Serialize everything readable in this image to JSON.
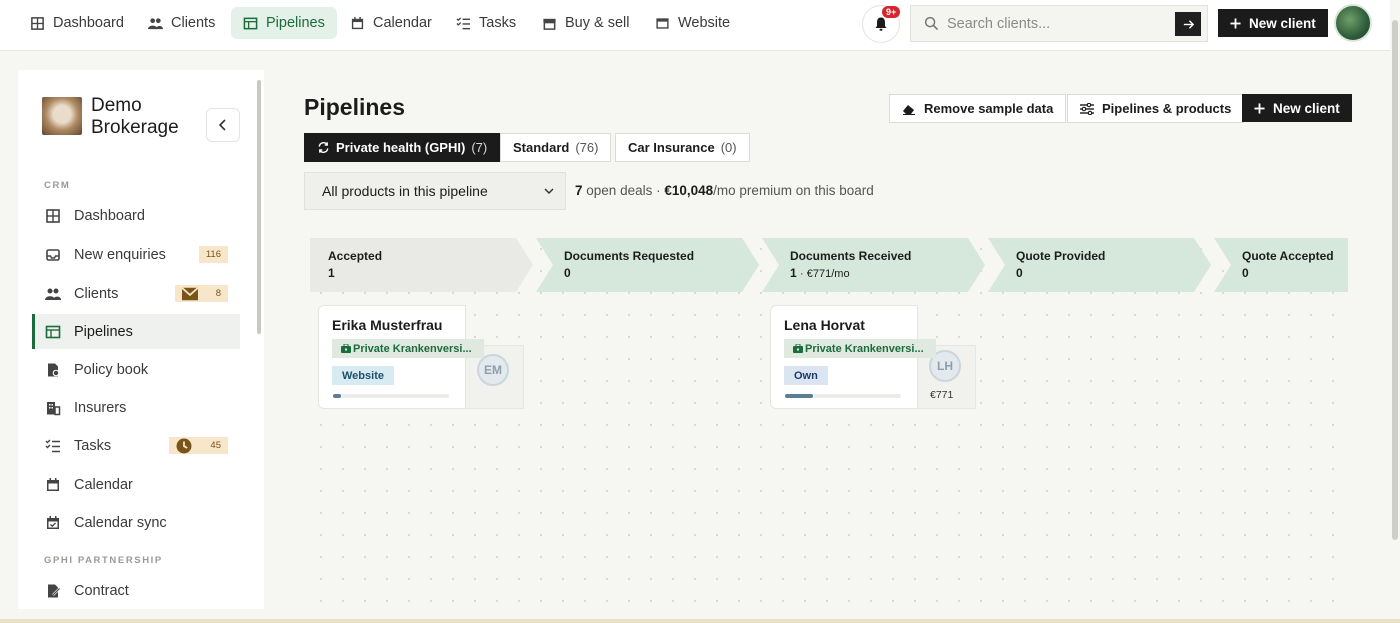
{
  "topnav": {
    "items": [
      {
        "label": "Dashboard",
        "icon": "grid-icon"
      },
      {
        "label": "Clients",
        "icon": "users-icon"
      },
      {
        "label": "Pipelines",
        "icon": "pipeline-icon",
        "active": true
      },
      {
        "label": "Calendar",
        "icon": "calendar-icon"
      },
      {
        "label": "Tasks",
        "icon": "tasks-icon"
      },
      {
        "label": "Buy & sell",
        "icon": "store-icon"
      },
      {
        "label": "Website",
        "icon": "browser-icon"
      }
    ],
    "notifications_badge": "9+",
    "search_placeholder": "Search clients...",
    "new_client_label": "New client"
  },
  "sidebar": {
    "brand": "Demo Brokerage",
    "section_crm": "CRM",
    "section_partnership": "GPHI PARTNERSHIP",
    "items": [
      {
        "label": "Dashboard",
        "icon": "grid-icon"
      },
      {
        "label": "New enquiries",
        "icon": "inbox-icon",
        "badge": "116"
      },
      {
        "label": "Clients",
        "icon": "users-icon",
        "badge": "8",
        "badge_icon": "mail-icon"
      },
      {
        "label": "Pipelines",
        "icon": "pipeline-icon",
        "active": true
      },
      {
        "label": "Policy book",
        "icon": "policy-icon"
      },
      {
        "label": "Insurers",
        "icon": "building-icon"
      },
      {
        "label": "Tasks",
        "icon": "tasks-icon",
        "badge": "45",
        "badge_icon": "clock-icon"
      },
      {
        "label": "Calendar",
        "icon": "calendar-icon"
      },
      {
        "label": "Calendar sync",
        "icon": "calendar-check-icon"
      },
      {
        "label": "Contract",
        "icon": "contract-icon"
      }
    ]
  },
  "main": {
    "title": "Pipelines",
    "actions": {
      "remove_sample": "Remove sample data",
      "pipelines_products": "Pipelines & products",
      "new_client": "New client"
    },
    "tabs": [
      {
        "label": "Private health (GPHI)",
        "count": "(7)",
        "active": true
      },
      {
        "label": "Standard",
        "count": "(76)"
      },
      {
        "label": "Car Insurance",
        "count": "(0)"
      }
    ],
    "product_filter": "All products in this pipeline",
    "summary": {
      "count": "7",
      "open_deals_text": "open deals ·",
      "premium": "€10,048",
      "suffix": "/mo premium on this board"
    }
  },
  "board": {
    "stages": [
      {
        "name": "Accepted",
        "count": "1",
        "premium": ""
      },
      {
        "name": "Documents Requested",
        "count": "0",
        "premium": ""
      },
      {
        "name": "Documents Received",
        "count": "1",
        "premium": "· €771/mo"
      },
      {
        "name": "Quote Provided",
        "count": "0",
        "premium": ""
      },
      {
        "name": "Quote Accepted",
        "count": "0",
        "premium": ""
      }
    ],
    "cards": [
      {
        "name": "Erika Musterfrau",
        "product": "Private Krankenversi...",
        "source": "Website",
        "initials": "EM",
        "amount": "",
        "progress": 0.07
      },
      {
        "name": "Lena Horvat",
        "product": "Private Krankenversi...",
        "source": "Own",
        "initials": "LH",
        "amount": "€771",
        "progress": 0.24
      }
    ]
  },
  "colors": {
    "accent_green": "#1c6b3d",
    "stage_grey": "#e9e9e6",
    "stage_green": "#d6e7dc",
    "badge_amber": "#f7e6c9",
    "notif_red": "#d6262b"
  }
}
